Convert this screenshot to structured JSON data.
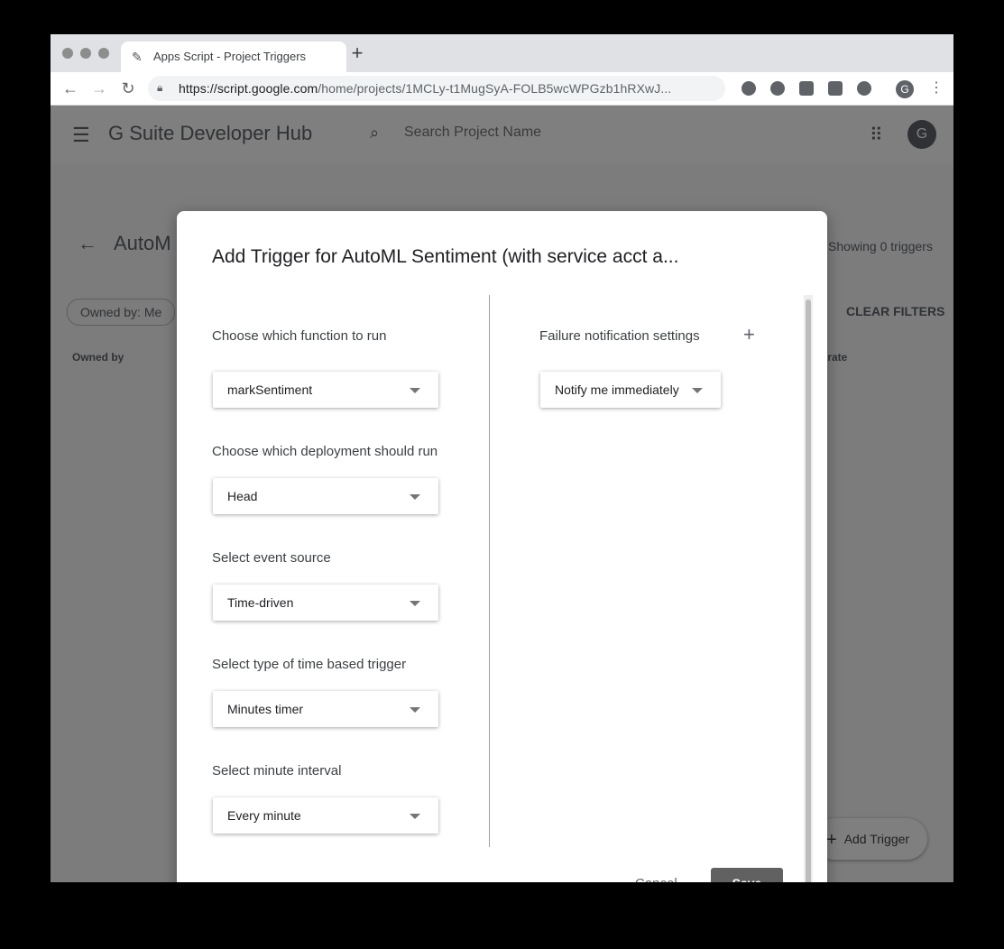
{
  "browser": {
    "tab_title": "Apps Script - Project Triggers",
    "new_tab_label": "+",
    "url_host": "https://script.google.com",
    "url_path": "/home/projects/1MCLy-t1MugSyA-FOLB5wcWPGzb1hRXwJ...",
    "profile_initial": "G"
  },
  "appbar": {
    "brand": "G Suite Developer Hub",
    "search_placeholder": "Search Project Name",
    "avatar_initial": "G"
  },
  "page": {
    "project_title": "AutoM",
    "showing": "Showing 0 triggers",
    "filter_chip": "Owned by: Me",
    "clear_filters": "CLEAR FILTERS",
    "col_owned_by": "Owned by",
    "col_error_rate": "or rate",
    "add_trigger": "Add Trigger"
  },
  "dialog": {
    "title": "Add Trigger for AutoML Sentiment (with service acct a...",
    "fields": [
      {
        "label": "Choose which function to run",
        "value": "markSentiment"
      },
      {
        "label": "Choose which deployment should run",
        "value": "Head"
      },
      {
        "label": "Select event source",
        "value": "Time-driven"
      },
      {
        "label": "Select type of time based trigger",
        "value": "Minutes timer"
      },
      {
        "label": "Select minute interval",
        "value": "Every minute"
      }
    ],
    "failure_label": "Failure notification settings",
    "failure_value": "Notify me immediately",
    "cancel_label": "Cancel",
    "save_label": "Save"
  },
  "icons": {
    "search": "search-icon",
    "menu": "hamburger-icon",
    "apps": "apps-grid-icon",
    "back": "arrow-back-icon",
    "add": "plus-icon",
    "dropdown": "caret-down-icon"
  },
  "colors": {
    "save_button": "#616161",
    "scrim": "#000000"
  }
}
